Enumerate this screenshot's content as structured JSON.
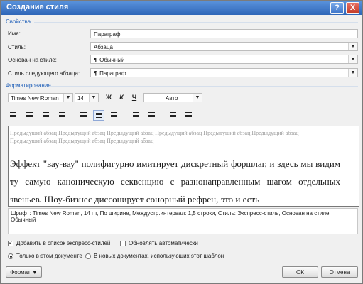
{
  "window": {
    "title": "Создание стиля",
    "help": "?",
    "close": "X"
  },
  "properties": {
    "section": "Свойства",
    "name_label": "Имя:",
    "name_value": "Параграф",
    "style_label": "Стиль:",
    "style_value": "Абзаца",
    "based_label": "Основан на стиле:",
    "based_value": "Обычный",
    "next_label": "Стиль следующего абзаца:",
    "next_value": "Параграф"
  },
  "formatting": {
    "section": "Форматирование",
    "font": "Times New Roman",
    "size": "14",
    "bold": "Ж",
    "italic": "К",
    "underline": "Ч",
    "color": "Авто"
  },
  "preview": {
    "previous_text": "Предыдущий абзац Предыдущий абзац Предыдущий абзац Предыдущий абзац Предыдущий абзац Предыдущий абзац Предыдущий абзац Предыдущий абзац Предыдущий абзац",
    "sample_text": "Эффект \"вау-вау\" полифигурно имитирует дискретный форшлаг, и здесь мы видим ту самую каноническую секвенцию с разнонаправленным шагом отдельных звеньев. Шоу-бизнес диссонирует сонорный рефрен, это и есть"
  },
  "description": "Шрифт: Times New Roman, 14 пт, По ширине, Междустр.интервал:  1,5 строки, Стиль: Экспресс-стиль, Основан на стиле: Обычный",
  "options": {
    "add_to_quick_styles": "Добавить в список экспресс-стилей",
    "auto_update": "Обновлять автоматически",
    "only_this_document": "Только в этом документе",
    "new_documents": "В новых документах, использующих этот шаблон"
  },
  "buttons": {
    "format": "Формат",
    "ok": "ОК",
    "cancel": "Отмена"
  },
  "icons": {
    "dropdown": "chevron-down-icon",
    "paragraph": "paragraph-mark-icon",
    "check": "check-icon"
  }
}
